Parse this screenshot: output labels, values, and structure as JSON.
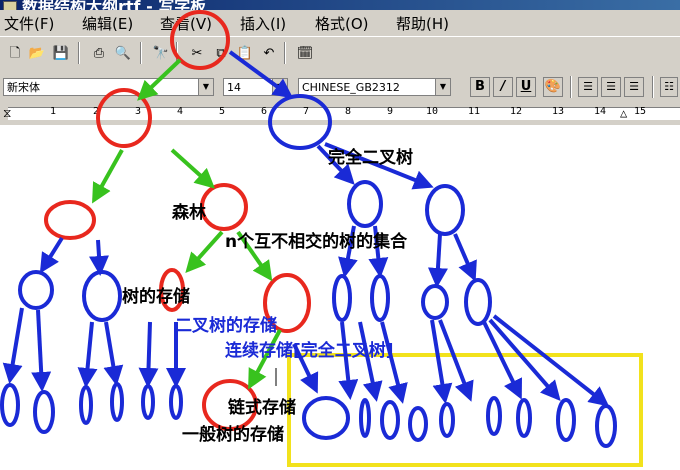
{
  "window": {
    "title": "数据结构大纲rtf - 写字板"
  },
  "menu": {
    "items": [
      "文件(F)",
      "编辑(E)",
      "查看(V)",
      "插入(I)",
      "格式(O)",
      "帮助(H)"
    ]
  },
  "format": {
    "font": "新宋体",
    "size": "14",
    "script": "CHINESE_GB2312",
    "bold": "B",
    "italic": "/",
    "underline": "U"
  },
  "ruler": {
    "marks": [
      "1",
      "2",
      "3",
      "4",
      "5",
      "6",
      "7",
      "8",
      "9",
      "10",
      "11",
      "12",
      "13",
      "14",
      "15"
    ]
  },
  "content": {
    "full_binary_tree": "完全二叉树",
    "forest": "森林",
    "forest_def": "n个互不相交的树的集合",
    "tree_storage": "树的存储",
    "binary_tree_storage": "二叉树的存储",
    "sequential_storage": "连续存储[完全二叉树]",
    "linked_storage": "链式存储",
    "general_tree_storage": "一般树的存储"
  },
  "colors": {
    "red": "#e8281e",
    "blue": "#1a2ad6",
    "green": "#38c21e",
    "yellow": "#f2e21c"
  }
}
